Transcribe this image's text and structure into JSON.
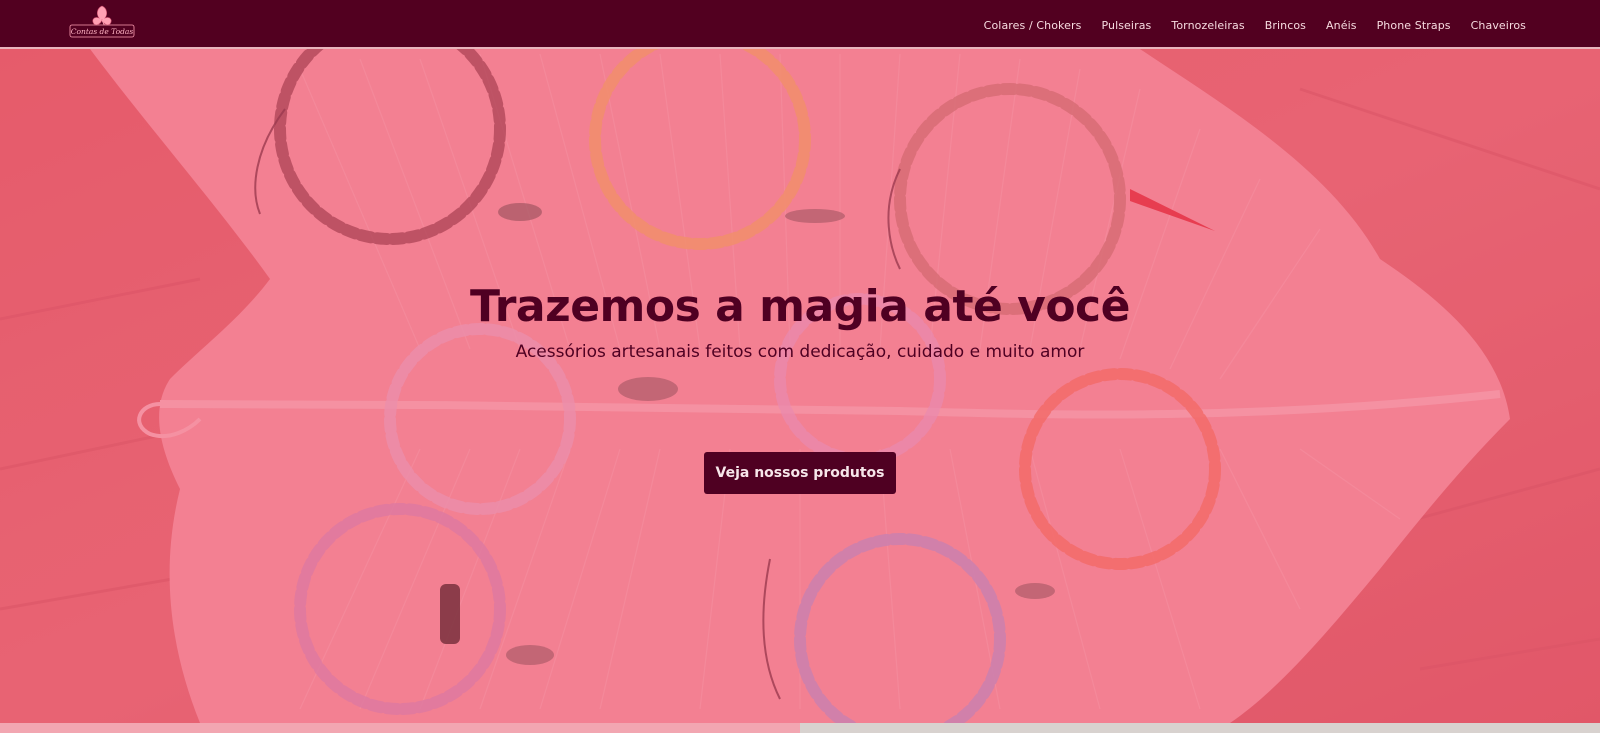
{
  "brand": {
    "logo_text": "Contas de Todas"
  },
  "nav": {
    "items": [
      {
        "label": "Colares / Chokers"
      },
      {
        "label": "Pulseiras"
      },
      {
        "label": "Tornozeleiras"
      },
      {
        "label": "Brincos"
      },
      {
        "label": "Anéis"
      },
      {
        "label": "Phone Straps"
      },
      {
        "label": "Chaveiros"
      }
    ]
  },
  "hero": {
    "title": "Trazemos a magia até você",
    "subtitle": "Acessórios artesanais feitos com dedicação, cuidado e muito amor",
    "cta_label": "Veja nossos produtos",
    "background_subject": "beaded bracelets on macramé feather"
  },
  "colors": {
    "navbar": "#520020",
    "accent_dark": "#4f0022",
    "hero_overlay": "#f06c84",
    "strip_pink": "#f2a6b1"
  }
}
